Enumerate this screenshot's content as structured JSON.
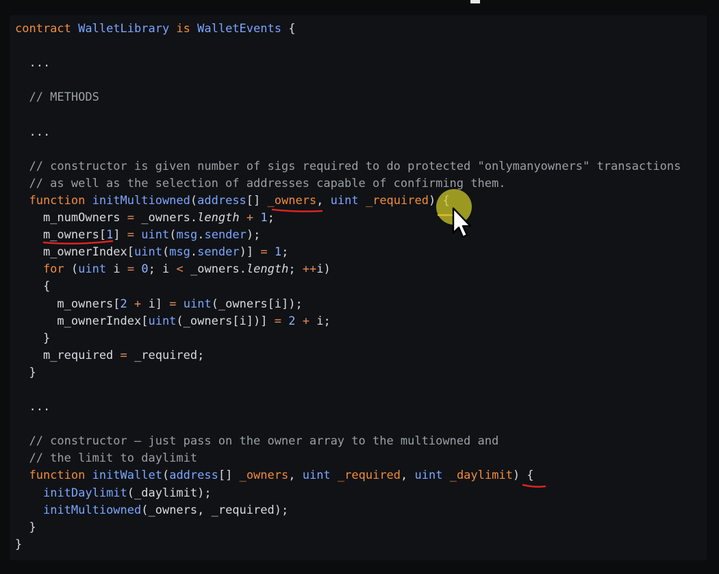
{
  "code": {
    "lines": [
      [
        [
          "kw",
          "contract "
        ],
        [
          "ty",
          "WalletLibrary"
        ],
        [
          "kw",
          " is "
        ],
        [
          "ty",
          "WalletEvents"
        ],
        [
          "pl",
          " {"
        ]
      ],
      [],
      [
        [
          "pl",
          "  ..."
        ]
      ],
      [],
      [
        [
          "cm",
          "  // METHODS"
        ]
      ],
      [],
      [
        [
          "pl",
          "  ..."
        ]
      ],
      [],
      [
        [
          "cm",
          "  // constructor is given number of sigs required to do protected \"onlymanyowners\" transactions"
        ]
      ],
      [
        [
          "cm",
          "  // as well as the selection of addresses capable of confirming them."
        ]
      ],
      [
        [
          "kw",
          "  function "
        ],
        [
          "fn",
          "initMultiowned"
        ],
        [
          "pl",
          "("
        ],
        [
          "ty",
          "address"
        ],
        [
          "pl",
          "[] "
        ],
        [
          "kw",
          "_owners"
        ],
        [
          "pl",
          ", "
        ],
        [
          "ty",
          "uint "
        ],
        [
          "kw",
          "_required"
        ],
        [
          "pl",
          ") {"
        ]
      ],
      [
        [
          "pl",
          "    m_numOwners "
        ],
        [
          "op",
          "="
        ],
        [
          "pl",
          " _owners."
        ],
        [
          "it",
          "length"
        ],
        [
          "pl",
          " "
        ],
        [
          "op",
          "+"
        ],
        [
          "pl",
          " "
        ],
        [
          "nm",
          "1"
        ],
        [
          "pl",
          ";"
        ]
      ],
      [
        [
          "pl",
          "    m_owners["
        ],
        [
          "nm",
          "1"
        ],
        [
          "pl",
          "] "
        ],
        [
          "op",
          "="
        ],
        [
          "pl",
          " "
        ],
        [
          "ty",
          "uint"
        ],
        [
          "pl",
          "("
        ],
        [
          "ty",
          "msg"
        ],
        [
          "pl",
          "."
        ],
        [
          "ty",
          "sender"
        ],
        [
          "pl",
          ");"
        ]
      ],
      [
        [
          "pl",
          "    m_ownerIndex["
        ],
        [
          "ty",
          "uint"
        ],
        [
          "pl",
          "("
        ],
        [
          "ty",
          "msg"
        ],
        [
          "pl",
          "."
        ],
        [
          "ty",
          "sender"
        ],
        [
          "pl",
          ")] "
        ],
        [
          "op",
          "="
        ],
        [
          "pl",
          " "
        ],
        [
          "nm",
          "1"
        ],
        [
          "pl",
          ";"
        ]
      ],
      [
        [
          "kw",
          "    for"
        ],
        [
          "pl",
          " ("
        ],
        [
          "ty",
          "uint"
        ],
        [
          "pl",
          " i "
        ],
        [
          "op",
          "="
        ],
        [
          "pl",
          " "
        ],
        [
          "nm",
          "0"
        ],
        [
          "pl",
          "; i "
        ],
        [
          "op",
          "<"
        ],
        [
          "pl",
          " _owners."
        ],
        [
          "it",
          "length"
        ],
        [
          "pl",
          "; "
        ],
        [
          "op",
          "++"
        ],
        [
          "pl",
          "i)"
        ]
      ],
      [
        [
          "pl",
          "    {"
        ]
      ],
      [
        [
          "pl",
          "      m_owners["
        ],
        [
          "nm",
          "2"
        ],
        [
          "pl",
          " "
        ],
        [
          "op",
          "+"
        ],
        [
          "pl",
          " i] "
        ],
        [
          "op",
          "="
        ],
        [
          "pl",
          " "
        ],
        [
          "ty",
          "uint"
        ],
        [
          "pl",
          "(_owners[i]);"
        ]
      ],
      [
        [
          "pl",
          "      m_ownerIndex["
        ],
        [
          "ty",
          "uint"
        ],
        [
          "pl",
          "(_owners[i])] "
        ],
        [
          "op",
          "="
        ],
        [
          "pl",
          " "
        ],
        [
          "nm",
          "2"
        ],
        [
          "pl",
          " "
        ],
        [
          "op",
          "+"
        ],
        [
          "pl",
          " i;"
        ]
      ],
      [
        [
          "pl",
          "    }"
        ]
      ],
      [
        [
          "pl",
          "    m_required "
        ],
        [
          "op",
          "="
        ],
        [
          "pl",
          " _required;"
        ]
      ],
      [
        [
          "pl",
          "  }"
        ]
      ],
      [],
      [
        [
          "pl",
          "  ..."
        ]
      ],
      [],
      [
        [
          "cm",
          "  // constructor – just pass on the owner array to the multiowned and"
        ]
      ],
      [
        [
          "cm",
          "  // the limit to daylimit"
        ]
      ],
      [
        [
          "kw",
          "  function "
        ],
        [
          "fn",
          "initWallet"
        ],
        [
          "pl",
          "("
        ],
        [
          "ty",
          "address"
        ],
        [
          "pl",
          "[] "
        ],
        [
          "kw",
          "_owners"
        ],
        [
          "pl",
          ", "
        ],
        [
          "ty",
          "uint "
        ],
        [
          "kw",
          "_required"
        ],
        [
          "pl",
          ", "
        ],
        [
          "ty",
          "uint "
        ],
        [
          "kw",
          "_daylimit"
        ],
        [
          "pl",
          ") {"
        ]
      ],
      [
        [
          "pl",
          "    "
        ],
        [
          "fn",
          "initDaylimit"
        ],
        [
          "pl",
          "(_daylimit);"
        ]
      ],
      [
        [
          "pl",
          "    "
        ],
        [
          "fn",
          "initMultiowned"
        ],
        [
          "pl",
          "(_owners, _required);"
        ]
      ],
      [
        [
          "pl",
          "  }"
        ]
      ],
      [
        [
          "pl",
          "}"
        ]
      ]
    ]
  },
  "colors": {
    "keyword": "#f28c38",
    "type": "#7aa6ff",
    "comment": "#9aa0a6",
    "plain": "#d7dbe0",
    "annotation_red": "#d8261f",
    "cursor_highlight": "#d2cd28"
  },
  "icons": {
    "cursor": "mouse-pointer-icon"
  }
}
